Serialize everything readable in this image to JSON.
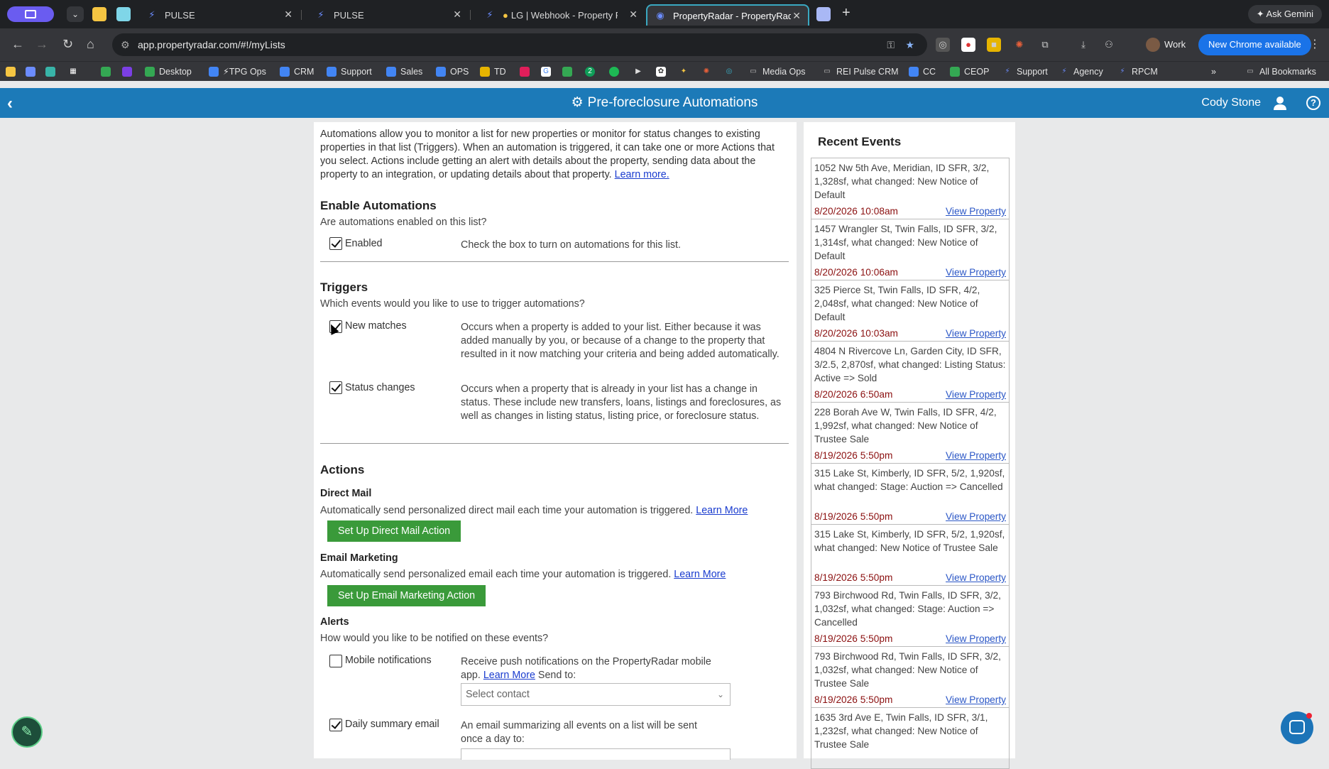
{
  "browser": {
    "tabs": [
      {
        "label": "PULSE",
        "active": false
      },
      {
        "label": "PULSE",
        "active": false
      },
      {
        "label": "LG | Webhook - Property R",
        "active": false
      },
      {
        "label": "PropertyRadar - PropertyRad",
        "active": true
      }
    ],
    "new_tab": "+",
    "ask_gemini": "Ask Gemini",
    "url": "app.propertyradar.com/#!/myLists",
    "profile_label": "Work",
    "update_label": "New Chrome available",
    "bookmarks": [
      {
        "label": "Desktop",
        "icon": "drive-icon",
        "color": "#34a853"
      },
      {
        "label": "⚡TPG Ops",
        "icon": "doc-icon",
        "color": "#4285f4"
      },
      {
        "label": "CRM",
        "icon": "doc-icon",
        "color": "#4285f4"
      },
      {
        "label": "Support",
        "icon": "doc-icon",
        "color": "#4285f4"
      },
      {
        "label": "Sales",
        "icon": "form-icon",
        "color": "#4285f4"
      },
      {
        "label": "OPS",
        "icon": "doc-icon",
        "color": "#4285f4"
      },
      {
        "label": "TD",
        "icon": "emoji-icon",
        "color": "#e6b400"
      },
      {
        "label": "Media Ops",
        "icon": "folder-icon",
        "color": "#888"
      },
      {
        "label": "REI Pulse CRM",
        "icon": "folder-icon",
        "color": "#888"
      },
      {
        "label": "CC",
        "icon": "form-icon",
        "color": "#4285f4"
      },
      {
        "label": "CEOP",
        "icon": "drive-icon",
        "color": "#34a853"
      },
      {
        "label": "Support",
        "icon": "bolt-icon",
        "color": "#6b8cff"
      },
      {
        "label": "Agency",
        "icon": "bolt-icon",
        "color": "#6b8cff"
      },
      {
        "label": "RPCM",
        "icon": "bolt-icon",
        "color": "#6b8cff"
      }
    ],
    "all_bookmarks": "All Bookmarks",
    "more_bookmarks": "»"
  },
  "header": {
    "title": "Pre-foreclosure Automations",
    "user": "Cody Stone",
    "color": "#1c7ab8"
  },
  "intro": {
    "text": "Automations allow you to monitor a list for new properties or monitor for status changes to existing properties in that list (Triggers). When an automation is triggered, it can take one or more Actions that you select. Actions include getting an alert with details about the property, sending data about the property to an integration, or updating details about that property. ",
    "learn_more": "Learn more."
  },
  "enable": {
    "heading": "Enable Automations",
    "question": "Are automations enabled on this list?",
    "label": "Enabled",
    "checked": true,
    "desc": "Check the box to turn on automations for this list."
  },
  "triggers": {
    "heading": "Triggers",
    "question": "Which events would you like to use to trigger automations?",
    "items": [
      {
        "label": "New matches",
        "checked": true,
        "desc": "Occurs when a property is added to your list. Either because it was added manually by you, or because of a change to the property that resulted in it now matching your criteria and being added automatically."
      },
      {
        "label": "Status changes",
        "checked": true,
        "desc": "Occurs when a property that is already in your list has a change in status. These include new transfers, loans, listings and foreclosures, as well as changes in listing status, listing price, or foreclosure status."
      }
    ]
  },
  "actions": {
    "heading": "Actions",
    "direct_mail": {
      "heading": "Direct Mail",
      "desc": "Automatically send personalized direct mail each time your automation is triggered. ",
      "learn_more": "Learn More",
      "button": "Set Up Direct Mail Action"
    },
    "email": {
      "heading": "Email Marketing",
      "desc": "Automatically send personalized email each time your automation is triggered. ",
      "learn_more": "Learn More",
      "button": "Set Up Email Marketing Action"
    },
    "alerts": {
      "heading": "Alerts",
      "question": "How would you like to be notified on these events?",
      "mobile": {
        "label": "Mobile notifications",
        "checked": false,
        "desc_a": "Receive push notifications on the PropertyRadar mobile app. ",
        "learn_more": "Learn More",
        "desc_b": " Send to:",
        "select_placeholder": "Select contact"
      },
      "daily": {
        "label": "Daily summary email",
        "checked": true,
        "desc": "An email summarizing all events on a list will be sent once a day to:"
      }
    }
  },
  "recent_events": {
    "title": "Recent Events",
    "link_label": "View Property",
    "items": [
      {
        "desc": "1052 Nw 5th Ave, Meridian, ID SFR, 3/2, 1,328sf, what changed: New Notice of Default",
        "ts": "8/20/2026 10:08am"
      },
      {
        "desc": "1457 Wrangler St, Twin Falls, ID SFR, 3/2, 1,314sf, what changed: New Notice of Default",
        "ts": "8/20/2026 10:06am"
      },
      {
        "desc": "325 Pierce St, Twin Falls, ID SFR, 4/2, 2,048sf, what changed: New Notice of Default",
        "ts": "8/20/2026 10:03am"
      },
      {
        "desc": "4804 N Rivercove Ln, Garden City, ID SFR, 3/2.5, 2,870sf, what changed: Listing Status: Active => Sold",
        "ts": "8/20/2026 6:50am"
      },
      {
        "desc": "228 Borah Ave W, Twin Falls, ID SFR, 4/2, 1,992sf, what changed: New Notice of Trustee Sale",
        "ts": "8/19/2026 5:50pm"
      },
      {
        "desc": "315 Lake St, Kimberly, ID SFR, 5/2, 1,920sf, what changed: Stage: Auction => Cancelled",
        "ts": "8/19/2026 5:50pm"
      },
      {
        "desc": "315 Lake St, Kimberly, ID SFR, 5/2, 1,920sf, what changed: New Notice of Trustee Sale",
        "ts": "8/19/2026 5:50pm"
      },
      {
        "desc": "793 Birchwood Rd, Twin Falls, ID SFR, 3/2, 1,032sf, what changed: Stage: Auction => Cancelled",
        "ts": "8/19/2026 5:50pm"
      },
      {
        "desc": "793 Birchwood Rd, Twin Falls, ID SFR, 3/2, 1,032sf, what changed: New Notice of Trustee Sale",
        "ts": "8/19/2026 5:50pm"
      },
      {
        "desc": "1635 3rd Ave E, Twin Falls, ID SFR, 3/1, 1,232sf, what changed: New Notice of Trustee Sale",
        "ts": ""
      }
    ]
  }
}
